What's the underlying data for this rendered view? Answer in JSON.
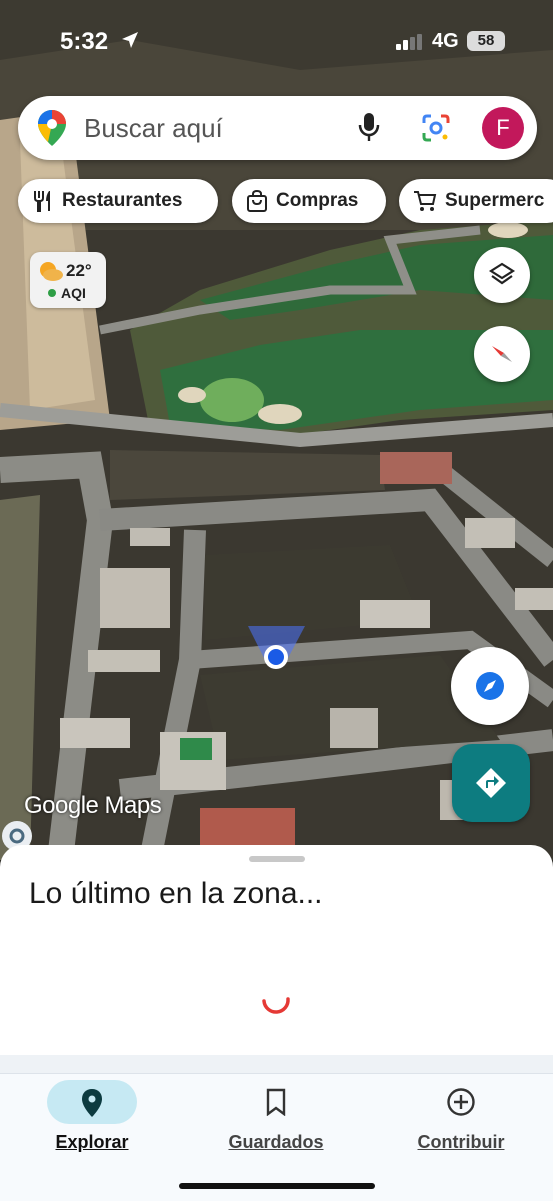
{
  "status_bar": {
    "time": "5:32",
    "network": "4G",
    "battery": "58"
  },
  "search": {
    "placeholder": "Buscar aquí",
    "avatar_initial": "F"
  },
  "chips": [
    {
      "label": "Restaurantes",
      "icon": "fork-knife-icon"
    },
    {
      "label": "Compras",
      "icon": "shopping-bag-icon"
    },
    {
      "label": "Supermerc",
      "icon": "cart-icon"
    }
  ],
  "weather": {
    "temperature": "22°",
    "aqi_label": "AQI"
  },
  "map": {
    "attribution": "Google Maps",
    "layer_type": "satellite"
  },
  "sheet": {
    "title": "Lo último en la zona..."
  },
  "bottom_nav": [
    {
      "label": "Explorar",
      "icon": "location-pin-icon",
      "active": true
    },
    {
      "label": "Guardados",
      "icon": "bookmark-icon",
      "active": false
    },
    {
      "label": "Contribuir",
      "icon": "add-circle-icon",
      "active": false
    }
  ],
  "colors": {
    "accent": "#0d7c80",
    "avatar": "#c2185b",
    "active_pill": "#c6e9f3",
    "location_dot": "#1a5be6"
  }
}
